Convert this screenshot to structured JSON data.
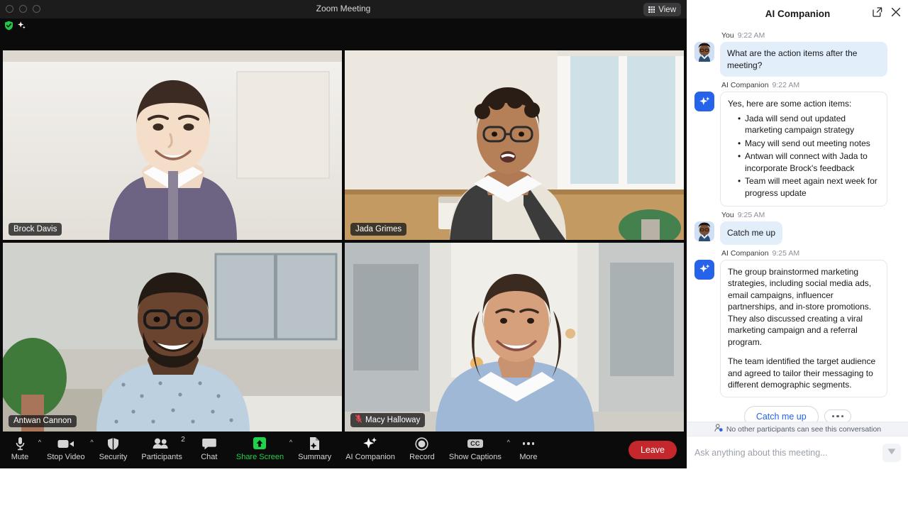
{
  "window": {
    "title": "Zoom Meeting",
    "view_button": "View",
    "view_icon": "grid-icon",
    "traffic_lights": [
      "close",
      "minimize",
      "maximize"
    ],
    "status_icons": [
      "shield-check-icon",
      "sparkle-icon"
    ]
  },
  "participants_grid": [
    {
      "name": "Brock Davis",
      "muted": false,
      "active_speaker": false
    },
    {
      "name": "Jada Grimes",
      "muted": false,
      "active_speaker": false
    },
    {
      "name": "Antwan Cannon",
      "muted": false,
      "active_speaker": true
    },
    {
      "name": "Macy Halloway",
      "muted": true,
      "active_speaker": false
    }
  ],
  "toolbar": {
    "items": [
      {
        "label": "Mute",
        "icon": "microphone-icon",
        "caret": true
      },
      {
        "label": "Stop Video",
        "icon": "video-camera-icon",
        "caret": true
      },
      {
        "label": "Security",
        "icon": "shield-icon",
        "caret": false
      },
      {
        "label": "Participants",
        "icon": "people-icon",
        "caret": false,
        "badge": "2"
      },
      {
        "label": "Chat",
        "icon": "chat-bubble-icon",
        "caret": false
      },
      {
        "label": "Share Screen",
        "icon": "share-screen-icon",
        "caret": true,
        "highlight": true
      },
      {
        "label": "Summary",
        "icon": "summary-doc-icon",
        "caret": false
      },
      {
        "label": "AI Companion",
        "icon": "sparkle-icon",
        "caret": false
      },
      {
        "label": "Record",
        "icon": "record-circle-icon",
        "caret": false
      },
      {
        "label": "Show Captions",
        "icon": "cc-icon",
        "caret": true
      },
      {
        "label": "More",
        "icon": "ellipsis-icon",
        "caret": false
      }
    ],
    "leave_label": "Leave",
    "leave_color": "#c4272c",
    "share_color": "#1fd14b"
  },
  "ai_panel": {
    "title": "AI Companion",
    "popout_icon": "external-link-icon",
    "close_icon": "close-icon",
    "messages": [
      {
        "sender": "You",
        "time": "9:22 AM",
        "type": "user",
        "text": "What are the action items after the meeting?"
      },
      {
        "sender": "AI Companion",
        "time": "9:22 AM",
        "type": "ai",
        "intro": "Yes, here are some action items:",
        "bullets": [
          "Jada will send out updated marketing campaign strategy",
          "Macy will send out meeting notes",
          "Antwan will connect with Jada to incorporate Brock's feedback",
          "Team will meet again next week for progress update"
        ]
      },
      {
        "sender": "You",
        "time": "9:25 AM",
        "type": "user",
        "text": "Catch me up"
      },
      {
        "sender": "AI Companion",
        "time": "9:25 AM",
        "type": "ai",
        "paragraph1": "The group brainstormed marketing strategies, including social media ads, email campaigns, influencer partnerships, and in-store promotions. They also discussed creating a viral marketing campaign and a referral program.",
        "paragraph2": "The team identified the target audience and agreed to tailor their messaging to different demographic segments."
      }
    ],
    "suggestions": {
      "primary": "Catch me up",
      "more_icon": "ellipsis-icon"
    },
    "privacy_note": "No other participants can see this conversation",
    "privacy_icon": "person-private-icon",
    "composer": {
      "placeholder": "Ask anything about this meeting...",
      "send_icon": "send-icon"
    },
    "accent_color": "#2563eb",
    "user_bubble_color": "#e3eefb"
  }
}
